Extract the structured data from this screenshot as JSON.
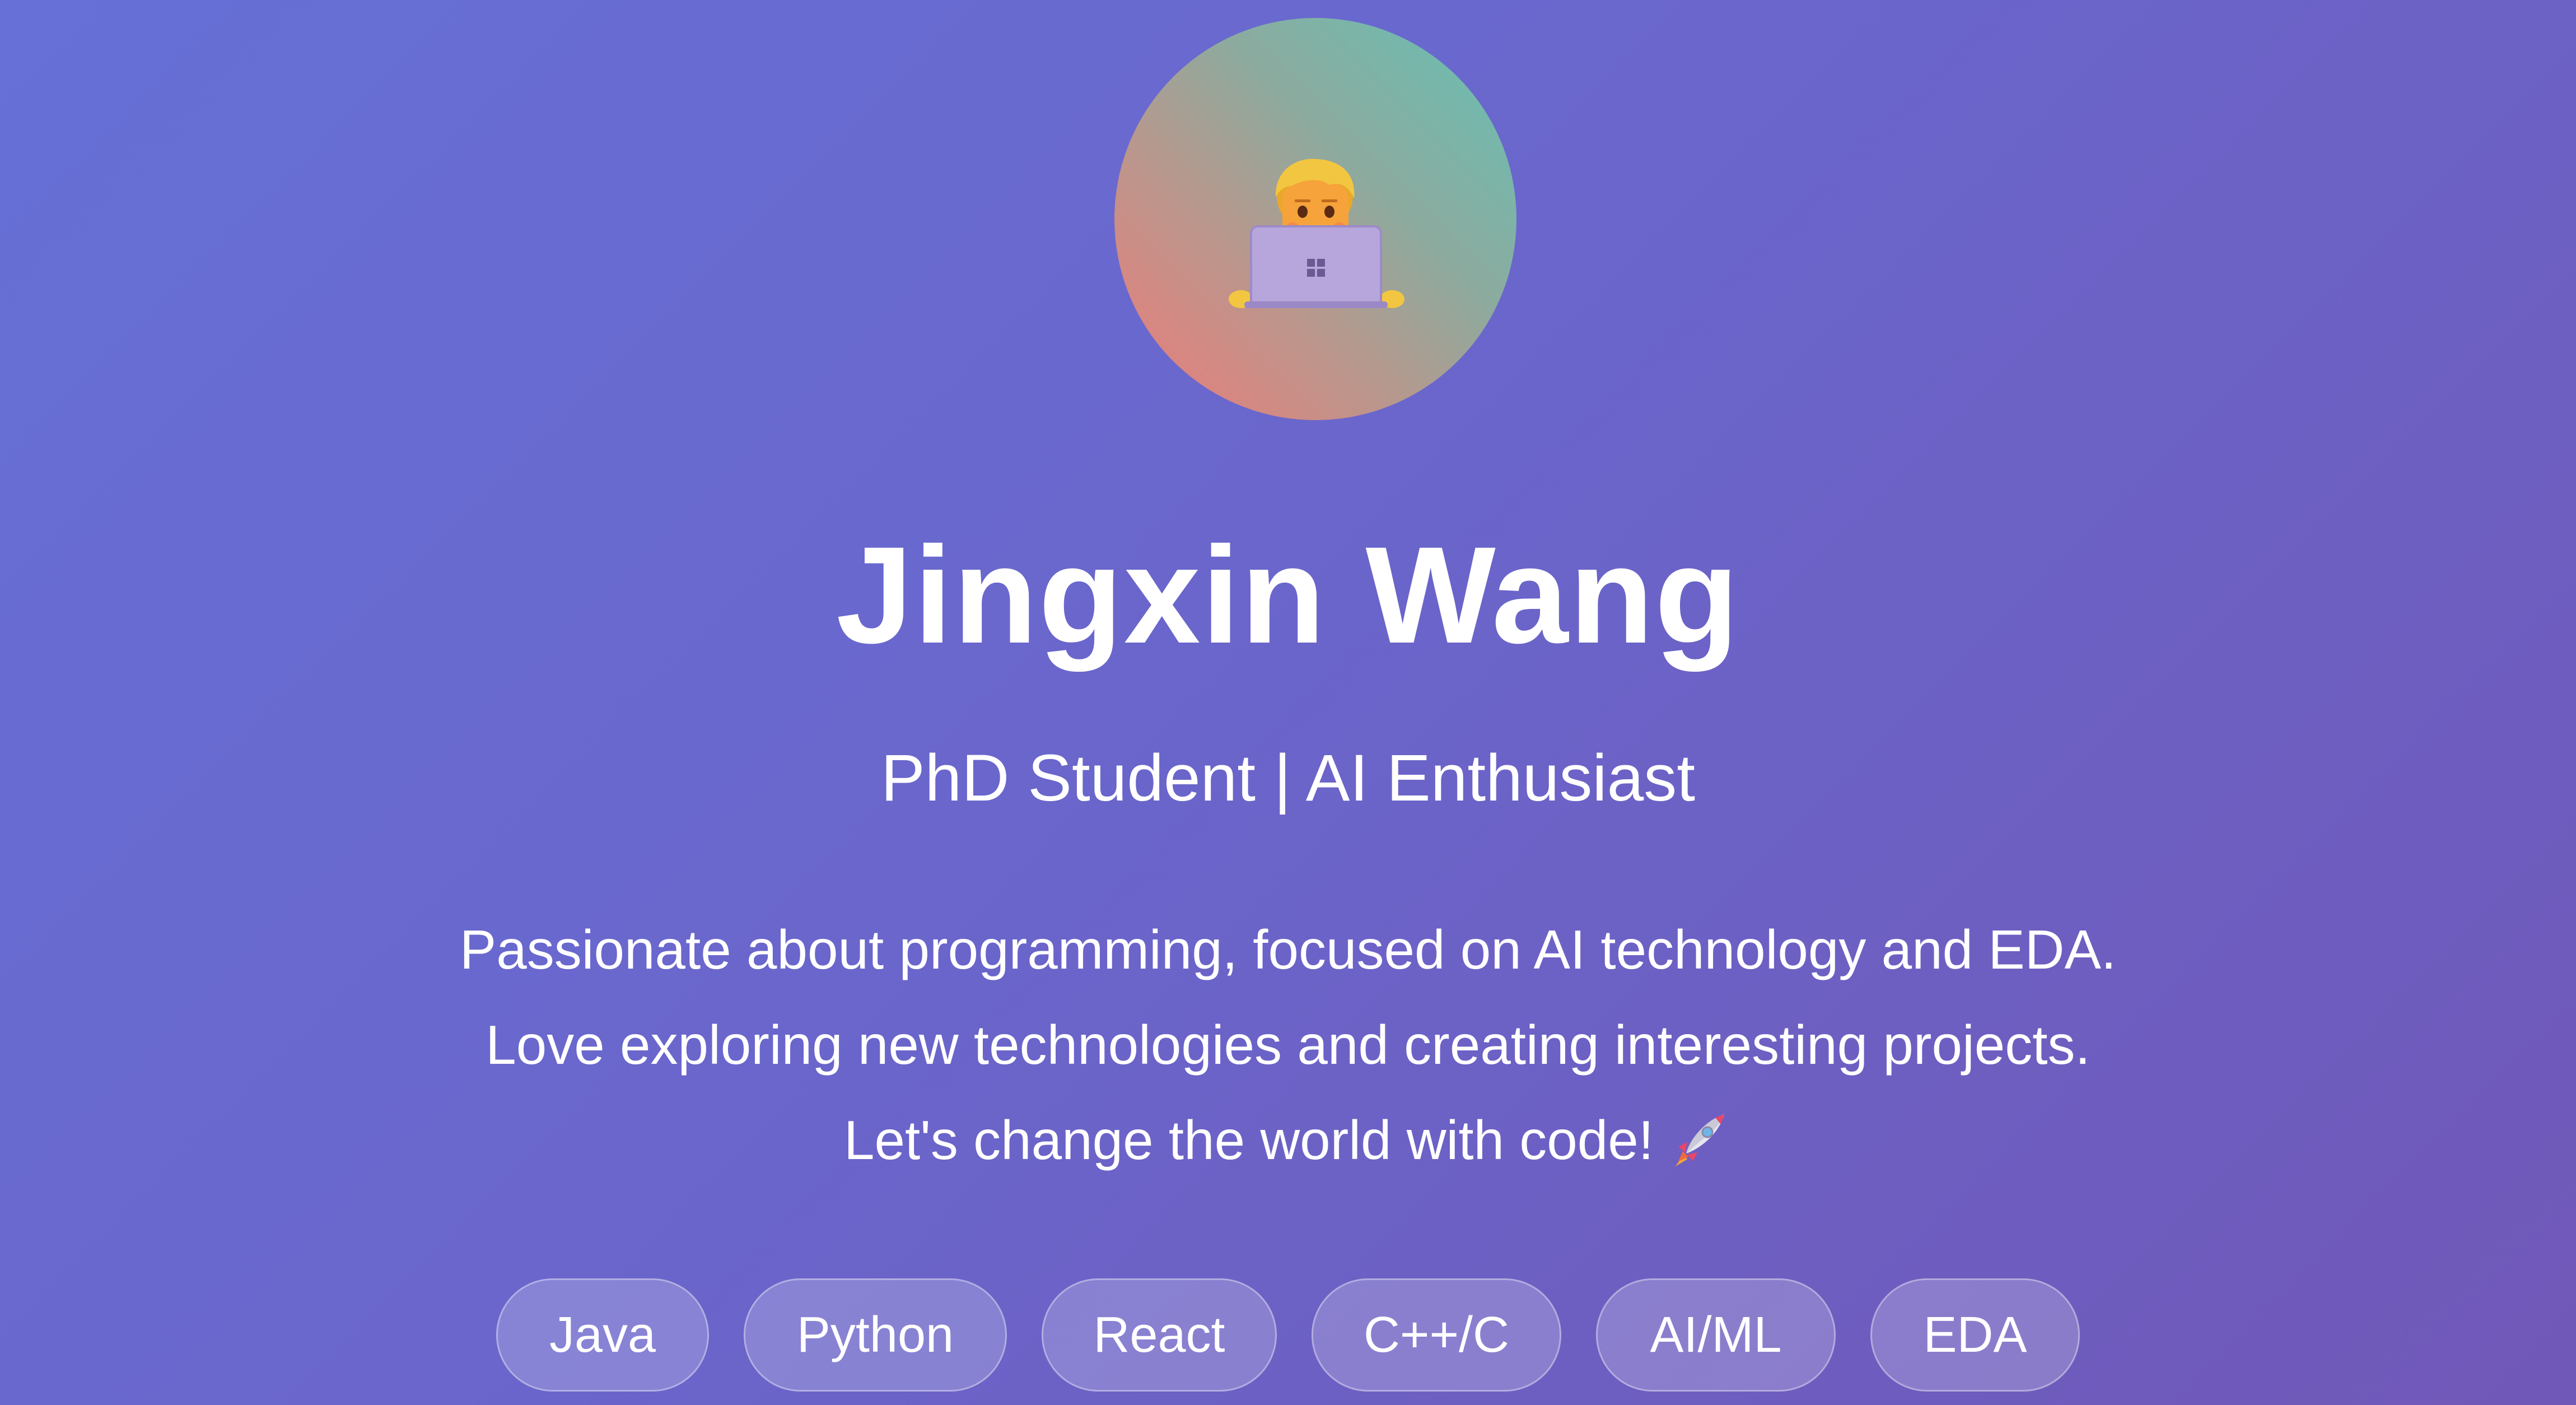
{
  "profile": {
    "name": "Jingxin Wang",
    "subtitle": "PhD Student | AI Enthusiast",
    "avatar_icon": "technologist-emoji-icon",
    "bio": [
      "Passionate about programming, focused on AI technology and EDA.",
      "Love exploring new technologies and creating interesting projects.",
      "Let's change the world with code!"
    ],
    "bio_icon": "rocket-icon"
  },
  "skills": [
    "Java",
    "Python",
    "React",
    "C++/C",
    "AI/ML",
    "EDA"
  ],
  "colors": {
    "background_start": "#6670d6",
    "background_end": "#7058b8",
    "avatar_gradient": [
      "#f07a78",
      "#66c0b5"
    ],
    "text": "#ffffff"
  }
}
